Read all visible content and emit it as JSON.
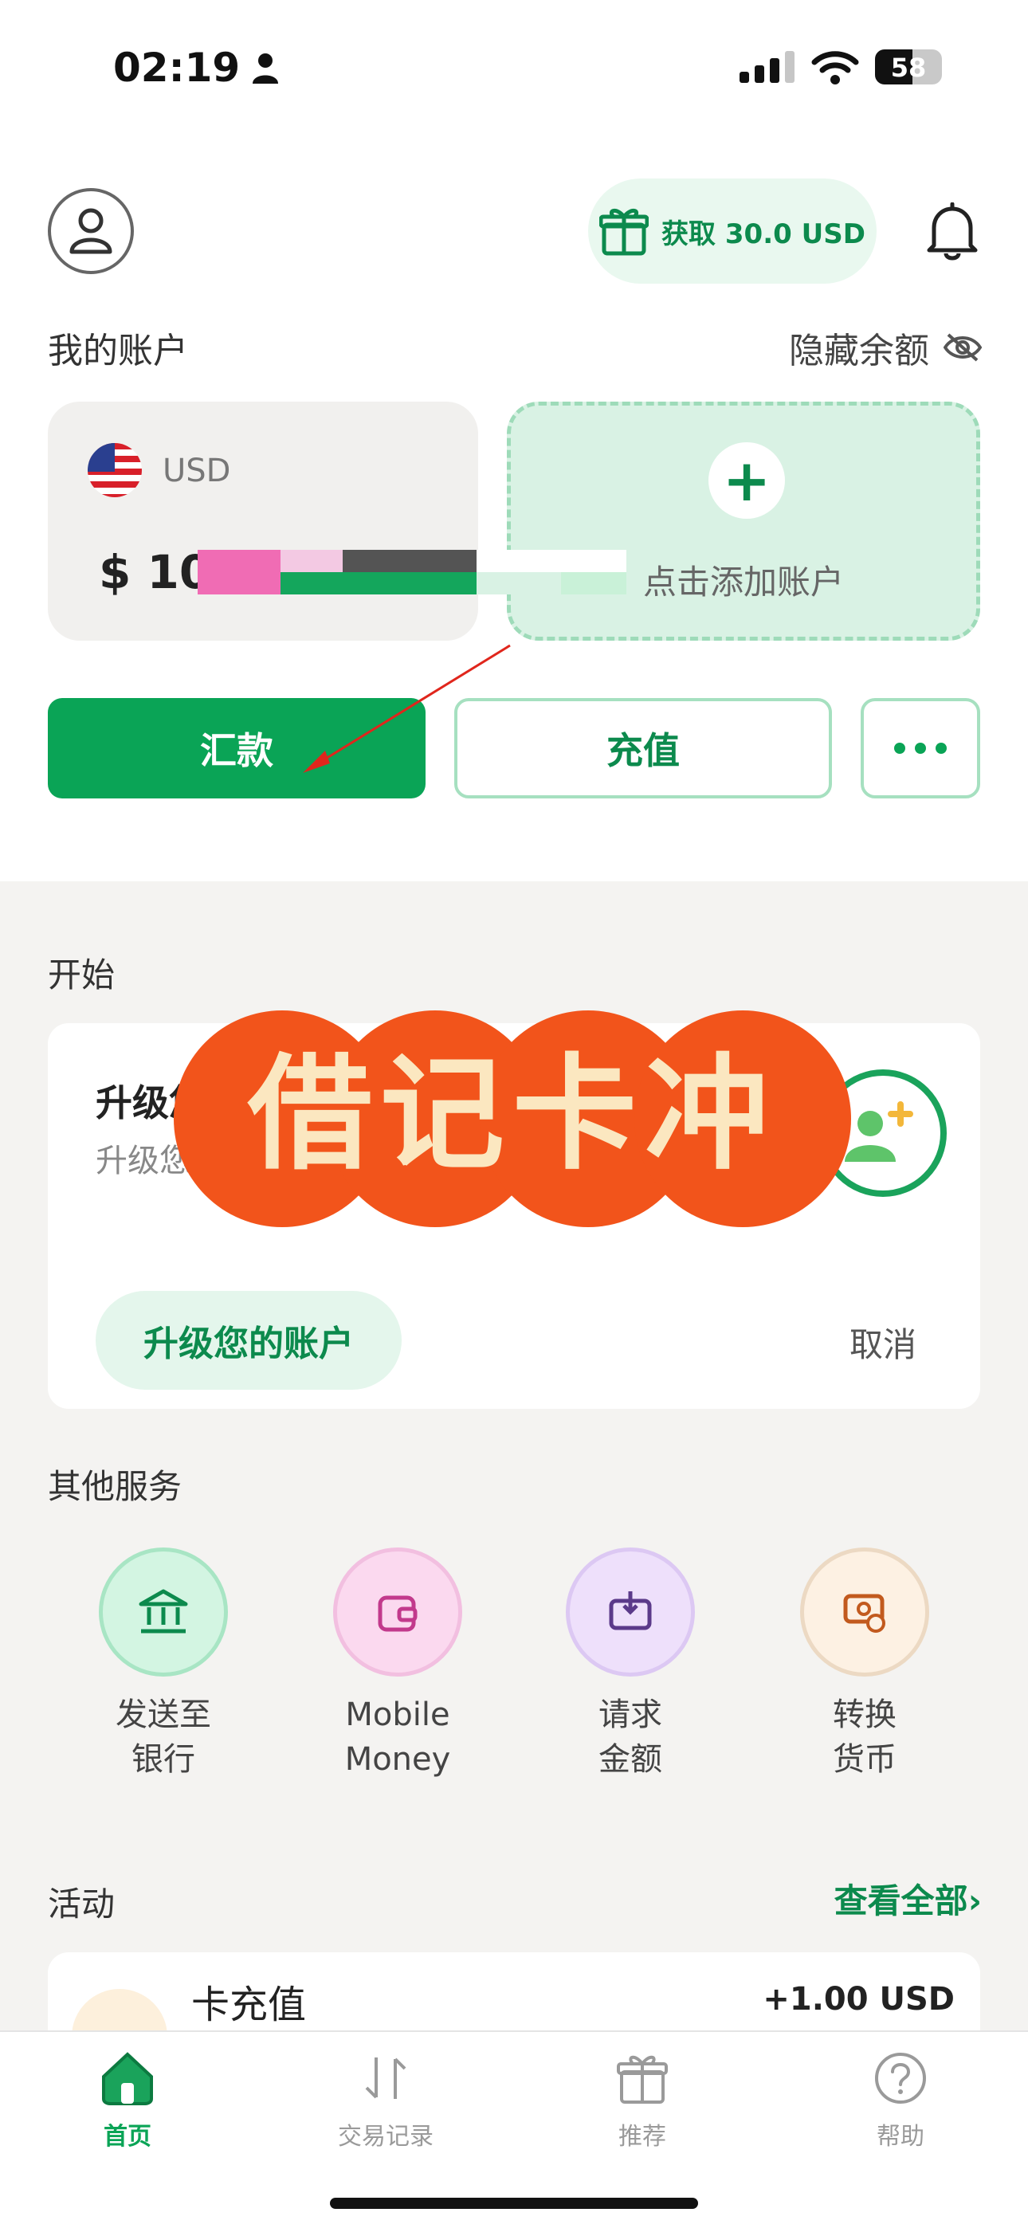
{
  "status_bar": {
    "time": "02:19",
    "battery": "58"
  },
  "header": {
    "reward_label": "获取 30.0 USD"
  },
  "accounts": {
    "title": "我的账户",
    "hide_balance": "隐藏余额",
    "usd_card": {
      "currency": "USD",
      "balance": "$ 10"
    },
    "add_card": {
      "label": "点击添加账户"
    }
  },
  "actions": {
    "send": "汇款",
    "topup": "充值"
  },
  "start": {
    "title": "开始",
    "card_title": "升级您",
    "card_subtitle": "升级您",
    "upgrade_button": "升级您的账户",
    "cancel": "取消",
    "overlay_text": "借记卡冲"
  },
  "services": {
    "title": "其他服务",
    "items": [
      {
        "line1": "发送至",
        "line2": "银行",
        "icon": "bank-icon",
        "bg": "#d3f5e2",
        "ring": "#a8e5c4"
      },
      {
        "line1": "Mobile",
        "line2": "Money",
        "icon": "wallet-icon",
        "bg": "#fbd9ef",
        "ring": "#f2bfe0"
      },
      {
        "line1": "请求",
        "line2": "金额",
        "icon": "request-icon",
        "bg": "#eee0fb",
        "ring": "#dcc8f3"
      },
      {
        "line1": "转换",
        "line2": "货币",
        "icon": "exchange-icon",
        "bg": "#fdf1e3",
        "ring": "#ecd9c3"
      }
    ]
  },
  "activity": {
    "title": "活动",
    "view_all": "查看全部",
    "items": [
      {
        "name": "卡充值",
        "amount": "+1.00 USD"
      }
    ]
  },
  "tabbar": {
    "items": [
      {
        "label": "首页",
        "icon": "home-icon",
        "active": true
      },
      {
        "label": "交易记录",
        "icon": "transactions-icon",
        "active": false
      },
      {
        "label": "推荐",
        "icon": "gift-icon",
        "active": false
      },
      {
        "label": "帮助",
        "icon": "help-icon",
        "active": false
      }
    ]
  },
  "colors": {
    "brand_green": "#0aa456",
    "dark_green": "#0c8a4d",
    "overlay_red": "#f2541b"
  }
}
